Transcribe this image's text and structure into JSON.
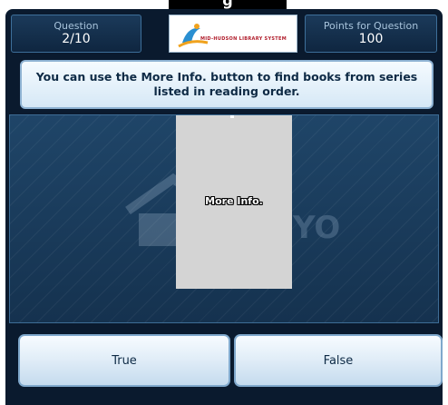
{
  "header": {
    "question_label": "Question",
    "question_value": "2/10",
    "points_label": "Points for Question",
    "points_value": "100",
    "logo_text": "MID-HUDSON LIBRARY SYSTEM",
    "top_cut_text": "g"
  },
  "question": {
    "text": "You can use the More Info. button to find books from series listed in reading order."
  },
  "stage": {
    "card_label": "More Info.",
    "watermark_text": "YO"
  },
  "answers": [
    {
      "label": "True"
    },
    {
      "label": "False"
    }
  ],
  "colors": {
    "frame": "#0a1a2e",
    "stage": "#1f4568",
    "logo_red": "#b01c2a",
    "logo_blue": "#2a8fd1",
    "logo_orange": "#f0a21d"
  }
}
